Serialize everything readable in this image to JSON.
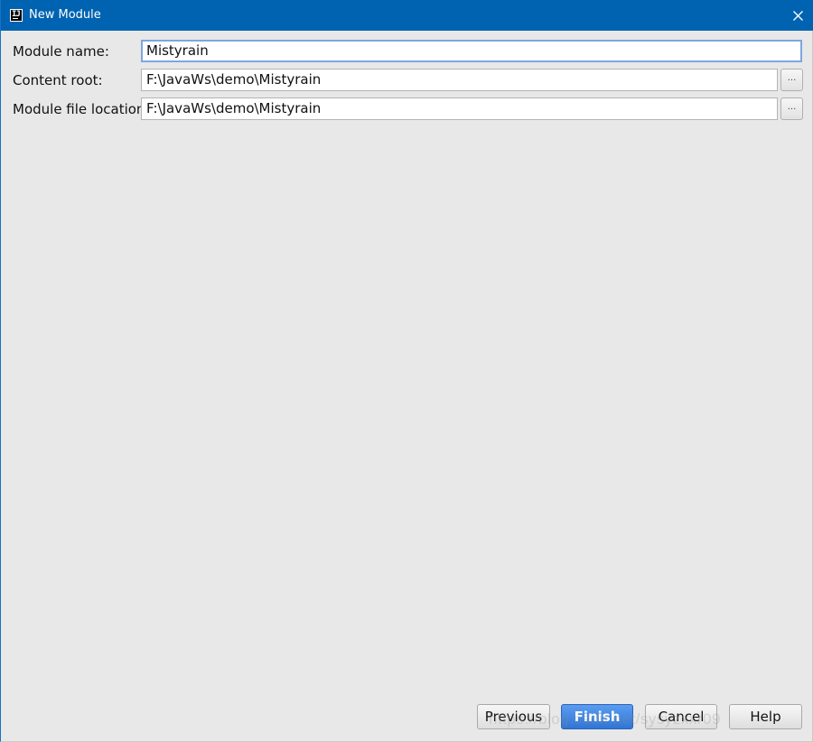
{
  "window": {
    "title": "New Module",
    "app_icon": "intellij-idea-icon",
    "close_icon": "close-icon",
    "titlebar_color": "#0063b1"
  },
  "form": {
    "module_name": {
      "label": "Module name:",
      "value": "Mistyrain"
    },
    "content_root": {
      "label": "Content root:",
      "value": "F:\\JavaWs\\demo\\Mistyrain",
      "browse_label": "..."
    },
    "module_file_location": {
      "label": "Module file location:",
      "value": "F:\\JavaWs\\demo\\Mistyrain",
      "browse_label": "..."
    }
  },
  "buttons": {
    "previous": "Previous",
    "finish": "Finish",
    "cancel": "Cancel",
    "help": "Help",
    "primary_color": "#3d84e0"
  },
  "watermark": "https://blog.csdn.net/sysyzxxr09"
}
